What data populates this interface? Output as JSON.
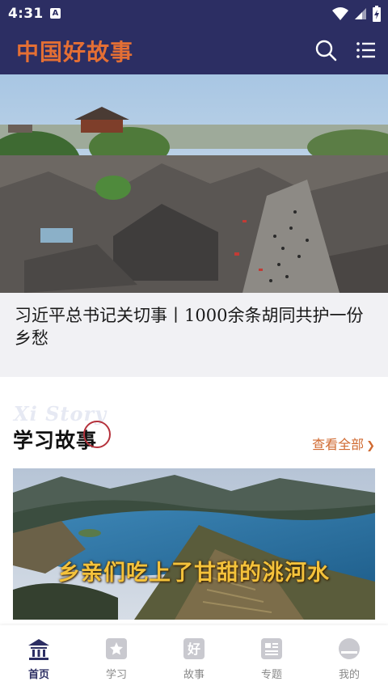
{
  "status_bar": {
    "time": "4:31",
    "notification_letter": "A",
    "icons": [
      "wifi-icon",
      "cell-signal-icon",
      "battery-charging-icon"
    ]
  },
  "app_bar": {
    "title": "中国好故事",
    "icons": [
      "search-icon",
      "list-menu-icon"
    ]
  },
  "hero": {
    "title": "习近平总书记关切事丨1000余条胡同共护一份乡愁",
    "image": "aerial-hutong-photo",
    "carousel_position": {
      "active": 1,
      "total": 1
    }
  },
  "section": {
    "watermark": "Xi Story",
    "title": "学习故事",
    "view_all_label": "查看全部"
  },
  "feature": {
    "caption": "乡亲们吃上了甘甜的洮河水",
    "image": "river-valley-photo"
  },
  "bottom_nav": {
    "items": [
      {
        "label": "首页",
        "icon": "home-icon",
        "active": true
      },
      {
        "label": "学习",
        "icon": "star-icon",
        "active": false
      },
      {
        "label": "故事",
        "icon": "story-icon",
        "active": false
      },
      {
        "label": "专题",
        "icon": "topic-icon",
        "active": false
      },
      {
        "label": "我的",
        "icon": "profile-icon",
        "active": false
      }
    ]
  },
  "colors": {
    "header_bg": "#2c2e63",
    "brand_orange": "#e46f34",
    "link_orange": "#d06a31",
    "circle_red": "#b5323c",
    "nav_active": "#2c2e63",
    "nav_inactive": "#888888"
  }
}
